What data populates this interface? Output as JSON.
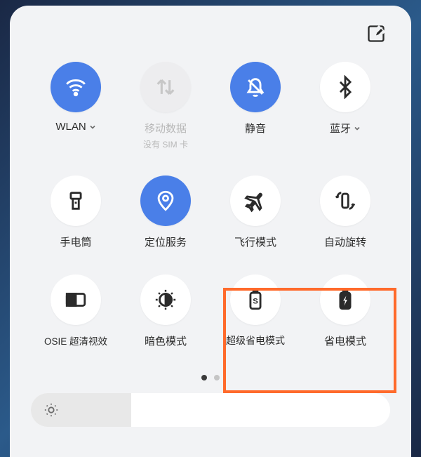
{
  "header": {
    "edit_icon": "edit-icon"
  },
  "tiles": [
    {
      "id": "wlan",
      "label": "WLAN",
      "has_chevron": true,
      "active": true,
      "sub": null
    },
    {
      "id": "mobiledata",
      "label": "移动数据",
      "has_chevron": false,
      "active": false,
      "sub": "没有 SIM 卡",
      "disabled": true
    },
    {
      "id": "mute",
      "label": "静音",
      "has_chevron": false,
      "active": true,
      "sub": null
    },
    {
      "id": "bluetooth",
      "label": "蓝牙",
      "has_chevron": true,
      "active": false,
      "sub": null
    },
    {
      "id": "flashlight",
      "label": "手电筒",
      "has_chevron": false,
      "active": false,
      "sub": null
    },
    {
      "id": "location",
      "label": "定位服务",
      "has_chevron": false,
      "active": true,
      "sub": null
    },
    {
      "id": "airplane",
      "label": "飞行模式",
      "has_chevron": false,
      "active": false,
      "sub": null
    },
    {
      "id": "autorotate",
      "label": "自动旋转",
      "has_chevron": false,
      "active": false,
      "sub": null
    },
    {
      "id": "osie",
      "label": "OSIE 超清视效",
      "has_chevron": false,
      "active": false,
      "sub": null
    },
    {
      "id": "darkmode",
      "label": "暗色模式",
      "has_chevron": false,
      "active": false,
      "sub": null
    },
    {
      "id": "superpowersave",
      "label": "超级省电模式",
      "has_chevron": false,
      "active": false,
      "sub": null
    },
    {
      "id": "powersave",
      "label": "省电模式",
      "has_chevron": false,
      "active": false,
      "sub": null
    }
  ],
  "pager": {
    "pages": 2,
    "current": 0
  },
  "brightness": {
    "value_pct": 28
  },
  "highlight": {
    "targets": [
      "superpowersave",
      "powersave"
    ]
  },
  "colors": {
    "accent": "#4a7fe8",
    "highlight_border": "#ff6a2b"
  }
}
